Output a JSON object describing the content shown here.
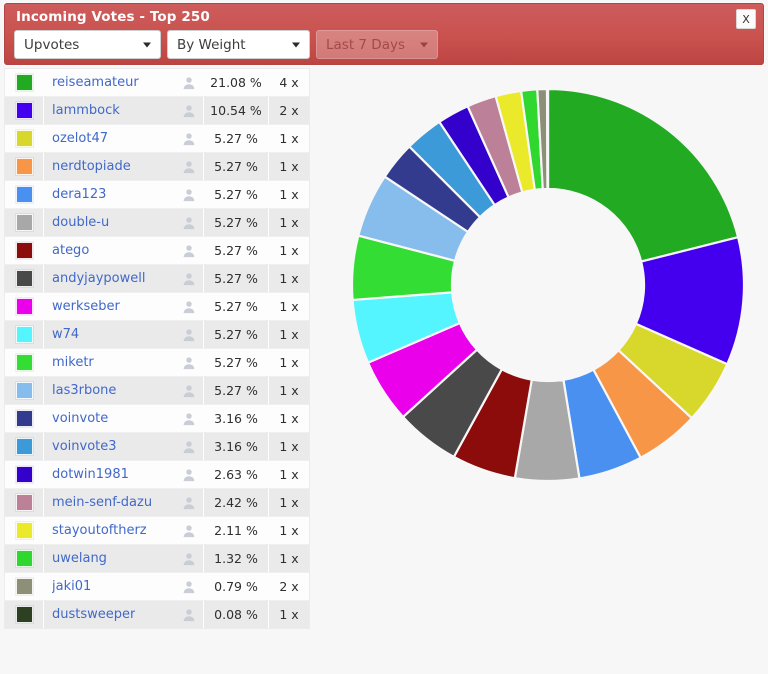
{
  "header": {
    "title": "Incoming Votes - Top 250",
    "close_label": "X",
    "accent_color": "#c9524f",
    "controls": [
      {
        "name": "metric",
        "value": "Upvotes",
        "disabled": false
      },
      {
        "name": "sort",
        "value": "By Weight",
        "disabled": false
      },
      {
        "name": "range",
        "value": "Last 7 Days",
        "disabled": true
      }
    ]
  },
  "table": {
    "icon": "person-icon",
    "rows": [
      {
        "color": "#22aa22",
        "name": "reiseamateur",
        "percent": "21.08 %",
        "count": "4 x"
      },
      {
        "color": "#4400ee",
        "name": "lammbock",
        "percent": "10.54 %",
        "count": "2 x"
      },
      {
        "color": "#d8d82c",
        "name": "ozelot47",
        "percent": "5.27 %",
        "count": "1 x"
      },
      {
        "color": "#f79646",
        "name": "nerdtopiade",
        "percent": "5.27 %",
        "count": "1 x"
      },
      {
        "color": "#4a90f0",
        "name": "dera123",
        "percent": "5.27 %",
        "count": "1 x"
      },
      {
        "color": "#a8a8a8",
        "name": "double-u",
        "percent": "5.27 %",
        "count": "1 x"
      },
      {
        "color": "#8c0b0b",
        "name": "atego",
        "percent": "5.27 %",
        "count": "1 x"
      },
      {
        "color": "#494949",
        "name": "andyjaypowell",
        "percent": "5.27 %",
        "count": "1 x"
      },
      {
        "color": "#ea00ea",
        "name": "werkseber",
        "percent": "5.27 %",
        "count": "1 x"
      },
      {
        "color": "#55f5ff",
        "name": "w74",
        "percent": "5.27 %",
        "count": "1 x"
      },
      {
        "color": "#33dd33",
        "name": "miketr",
        "percent": "5.27 %",
        "count": "1 x"
      },
      {
        "color": "#86bdec",
        "name": "las3rbone",
        "percent": "5.27 %",
        "count": "1 x"
      },
      {
        "color": "#333b8f",
        "name": "voinvote",
        "percent": "3.16 %",
        "count": "1 x"
      },
      {
        "color": "#3d9ad8",
        "name": "voinvote3",
        "percent": "3.16 %",
        "count": "1 x"
      },
      {
        "color": "#3300cc",
        "name": "dotwin1981",
        "percent": "2.63 %",
        "count": "1 x"
      },
      {
        "color": "#bd8099",
        "name": "mein-senf-dazu",
        "percent": "2.42 %",
        "count": "1 x"
      },
      {
        "color": "#eaea2a",
        "name": "stayoutoftherz",
        "percent": "2.11 %",
        "count": "1 x"
      },
      {
        "color": "#2fd72f",
        "name": "uwelang",
        "percent": "1.32 %",
        "count": "1 x"
      },
      {
        "color": "#8d8f76",
        "name": "jaki01",
        "percent": "0.79 %",
        "count": "2 x"
      },
      {
        "color": "#2d4021",
        "name": "dustsweeper",
        "percent": "0.08 %",
        "count": "1 x"
      }
    ]
  },
  "chart_data": {
    "type": "pie",
    "variant": "donut",
    "title": "Incoming Votes - Top 250",
    "start_angle_deg": 0,
    "direction": "clockwise",
    "inner_radius_ratio": 0.49,
    "legend": "left-table",
    "labels": [
      "reiseamateur",
      "lammbock",
      "ozelot47",
      "nerdtopiade",
      "dera123",
      "double-u",
      "atego",
      "andyjaypowell",
      "werkseber",
      "w74",
      "miketr",
      "las3rbone",
      "voinvote",
      "voinvote3",
      "dotwin1981",
      "mein-senf-dazu",
      "stayoutoftherz",
      "uwelang",
      "jaki01",
      "dustsweeper"
    ],
    "values": [
      21.08,
      10.54,
      5.27,
      5.27,
      5.27,
      5.27,
      5.27,
      5.27,
      5.27,
      5.27,
      5.27,
      5.27,
      3.16,
      3.16,
      2.63,
      2.42,
      2.11,
      1.32,
      0.79,
      0.08
    ],
    "colors": [
      "#22aa22",
      "#4400ee",
      "#d8d82c",
      "#f79646",
      "#4a90f0",
      "#a8a8a8",
      "#8c0b0b",
      "#494949",
      "#ea00ea",
      "#55f5ff",
      "#33dd33",
      "#86bdec",
      "#333b8f",
      "#3d9ad8",
      "#3300cc",
      "#bd8099",
      "#eaea2a",
      "#2fd72f",
      "#8d8f76",
      "#2d4021"
    ],
    "counts": [
      4,
      2,
      1,
      1,
      1,
      1,
      1,
      1,
      1,
      1,
      1,
      1,
      1,
      1,
      1,
      1,
      1,
      1,
      2,
      1
    ],
    "unit": "%"
  }
}
